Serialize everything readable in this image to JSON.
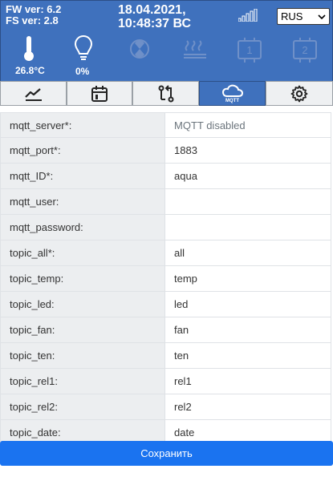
{
  "header": {
    "fw": "FW ver: 6.2",
    "fs": "FS ver: 2.8",
    "date": "18.04.2021,",
    "time": "10:48:37 ВС",
    "language": "RUS",
    "temperature": "26.8°C",
    "lamp_level": "0%"
  },
  "tabs": [
    {
      "icon": "chart-icon"
    },
    {
      "icon": "calendar-icon"
    },
    {
      "icon": "git-compare-icon"
    },
    {
      "icon": "cloud-icon",
      "label": "MQTT"
    },
    {
      "icon": "gear-icon"
    }
  ],
  "form": {
    "rows": [
      {
        "label": "mqtt_server*:",
        "value": "",
        "placeholder": "MQTT disabled"
      },
      {
        "label": "mqtt_port*:",
        "value": "1883"
      },
      {
        "label": "mqtt_ID*:",
        "value": "aqua"
      },
      {
        "label": "mqtt_user:",
        "value": ""
      },
      {
        "label": "mqtt_password:",
        "value": ""
      },
      {
        "label": "topic_all*:",
        "value": "all"
      },
      {
        "label": "topic_temp:",
        "value": "temp"
      },
      {
        "label": "topic_led:",
        "value": "led"
      },
      {
        "label": "topic_fan:",
        "value": "fan"
      },
      {
        "label": "topic_ten:",
        "value": "ten"
      },
      {
        "label": "topic_rel1:",
        "value": "rel1"
      },
      {
        "label": "topic_rel2:",
        "value": "rel2"
      },
      {
        "label": "topic_date:",
        "value": "date"
      }
    ],
    "save_label": "Сохранить"
  },
  "colors": {
    "header": "#3f71bd",
    "save": "#1a73f0"
  }
}
